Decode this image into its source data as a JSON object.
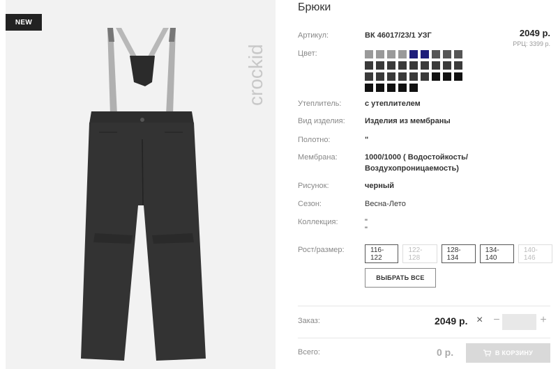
{
  "photo": {
    "badge": "NEW",
    "brand": "crockid"
  },
  "product": {
    "title": "Брюки",
    "price": "2049 р.",
    "rrp": "РРЦ: 3399 р."
  },
  "attributes": {
    "article_label": "Артикул:",
    "article_value": "ВК 46017/23/1 УЗГ",
    "color_label": "Цвет:",
    "insulation_label": "Утеплитель:",
    "insulation_value": "с утеплителем",
    "type_label": "Вид изделия:",
    "type_value": "Изделия из мембраны",
    "fabric_label": "Полотно:",
    "fabric_value": "\"",
    "membrane_label": "Мембрана:",
    "membrane_value_line1": "1000/1000 ( Водостойкость/",
    "membrane_value_line2": "Воздухопроницаемость)",
    "pattern_label": "Рисунок:",
    "pattern_value": "черный",
    "season_label": "Сезон:",
    "season_value": "Весна-Лето",
    "collection_label": "Коллекция:",
    "collection_value_line1": "\"",
    "collection_value_line2": "\""
  },
  "colors": {
    "rows": [
      [
        "#9a9a9a",
        "#9a9a9a",
        "#9a9a9a",
        "#9a9a9a",
        "#1f1f7a",
        "#1f1f7a",
        "#555555",
        "#555555",
        "#555555"
      ],
      [
        "#3a3a3a",
        "#3a3a3a",
        "#3a3a3a",
        "#3a3a3a",
        "#3a3a3a",
        "#3a3a3a",
        "#3a3a3a",
        "#3a3a3a",
        "#3a3a3a"
      ],
      [
        "#3a3a3a",
        "#3a3a3a",
        "#3a3a3a",
        "#3a3a3a",
        "#3a3a3a",
        "#3a3a3a",
        "#111111",
        "#111111",
        "#111111"
      ],
      [
        "#111111",
        "#111111",
        "#111111",
        "#111111",
        "#111111"
      ]
    ],
    "selected": "row3-col7"
  },
  "sizes": {
    "label": "Рост/размер:",
    "options": [
      {
        "label": "116-122",
        "available": true
      },
      {
        "label": "122-128",
        "available": false
      },
      {
        "label": "128-134",
        "available": true
      },
      {
        "label": "134-140",
        "available": true
      },
      {
        "label": "140-146",
        "available": false
      }
    ],
    "select_all": "ВЫБРАТЬ ВСЕ"
  },
  "order": {
    "label": "Заказ:",
    "price": "2049 р.",
    "remove": "×",
    "minus": "−",
    "plus": "+",
    "qty_value": ""
  },
  "total": {
    "label": "Всего:",
    "price": "0 р.",
    "cart_button": "В КОРЗИНУ",
    "cart_icon": "cart-icon"
  }
}
